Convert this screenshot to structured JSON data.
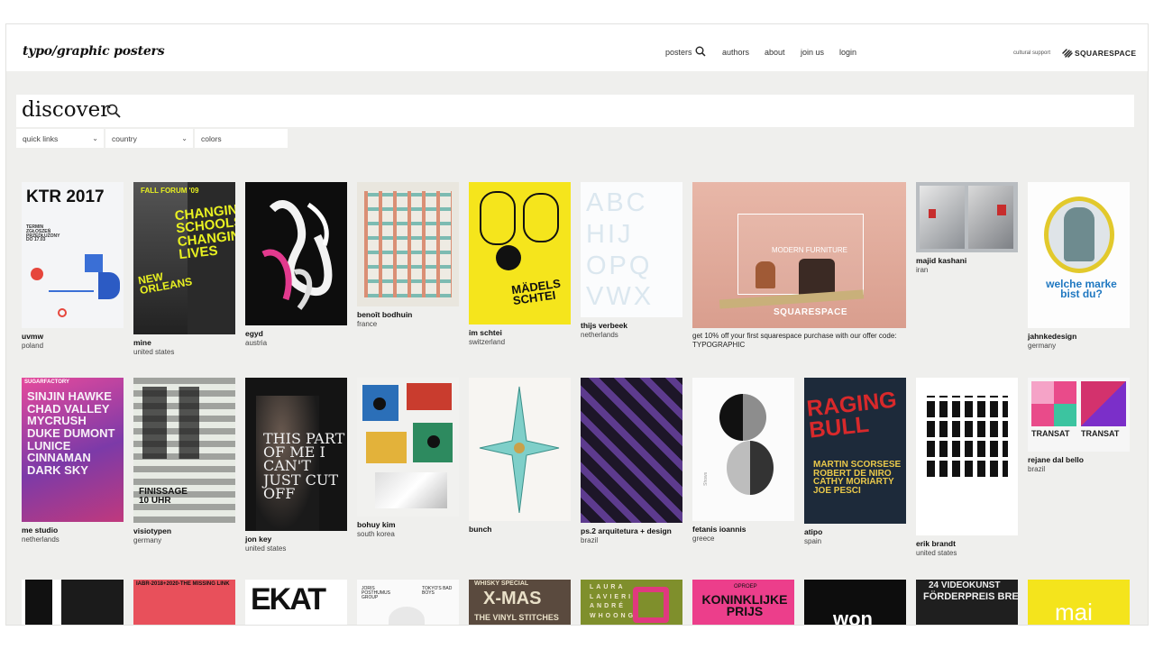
{
  "site": {
    "title": "typo/graphic posters"
  },
  "nav": {
    "items": [
      {
        "label": "posters"
      },
      {
        "label": "authors"
      },
      {
        "label": "about"
      },
      {
        "label": "join us"
      },
      {
        "label": "login"
      }
    ]
  },
  "sponsor": {
    "label": "cultural support",
    "name": "SQUARESPACE"
  },
  "discover": {
    "title": "discover"
  },
  "filters": {
    "quick_links": "quick links",
    "country": "country",
    "colors": "colors"
  },
  "row1": [
    {
      "author": "uvmw",
      "country": "poland",
      "text": "KTR 2017",
      "text_small": "TERMIN ZGŁOSZEŃ PRZEDŁUŻONY DO 17.03"
    },
    {
      "author": "mine",
      "country": "united states",
      "text": "CHANGING SCHOOLS CHANGING LIVES",
      "text_small": "NEW ORLEANS",
      "text_top": "FALL FORUM '09"
    },
    {
      "author": "egyd",
      "country": "austria"
    },
    {
      "author": "benoît bodhuin",
      "country": "france"
    },
    {
      "author": "im schtei",
      "country": "switzerland",
      "text": "MÄDELS SCHTEI"
    },
    {
      "author": "thijs verbeek",
      "country": "netherlands",
      "text": "ABC HIJ OPQ VWX"
    },
    {
      "ad_text": "get 10% off your first squarespace purchase with our offer code: TYPOGRAPHIC",
      "ad_brand": "SQUARESPACE",
      "ad_headline": "MODERN FURNITURE"
    },
    {
      "author": "majid kashani",
      "country": "iran"
    },
    {
      "author": "jahnkedesign",
      "country": "germany",
      "text": "welche marke bist du?"
    }
  ],
  "row2": [
    {
      "author": "me studio",
      "country": "netherlands",
      "text": "SINJIN HAWKE CHAD VALLEY MYCRUSH DUKE DUMONT LUNICE CINNAMAN DARK SKY",
      "text_top": "SUGARFACTORY"
    },
    {
      "author": "visiotypen",
      "country": "germany",
      "text": "FINISSAGE 10 UHR"
    },
    {
      "author": "jon key",
      "country": "united states",
      "text": "THIS PART OF ME I CAN'T JUST CUT OFF"
    },
    {
      "author": "bohuy kim",
      "country": "south korea"
    },
    {
      "author": "bunch",
      "country": ""
    },
    {
      "author": "ps.2 arquitetura + design",
      "country": "brazil"
    },
    {
      "author": "fetanis ioannis",
      "country": "greece",
      "text": "Shows"
    },
    {
      "author": "atipo",
      "country": "spain",
      "text": "RAGING BULL",
      "text_small": "MARTIN SCORSESE ROBERT DE NIRO CATHY MORIARTY JOE PESCI"
    },
    {
      "author": "erik brandt",
      "country": "united states"
    },
    {
      "author": "rejane dal bello",
      "country": "brazil",
      "text": "TRANSAT"
    }
  ],
  "row3": [
    {
      "text": ""
    },
    {
      "text": "IABR-2018+2020-THE MISSING LINK"
    },
    {
      "text": "EKAT"
    },
    {
      "text": "JORIS POSTHUMUS GROUP",
      "text_small": "TOKYO'S BAD BOYS"
    },
    {
      "text": "X-MAS",
      "text_top": "WHISKY SPECIAL",
      "text_small": "THE VINYL STITCHES"
    },
    {
      "text": "LAURA LAVIERI ANDRÉ WHOONG"
    },
    {
      "text": "KONINKLIJKE PRIJS",
      "text_top": "OPROEP"
    },
    {
      "text": "won"
    },
    {
      "text": "FÖRDERPREIS BREMEN",
      "text_top": "24 VIDEOKUNST"
    },
    {
      "text": "mai"
    }
  ]
}
